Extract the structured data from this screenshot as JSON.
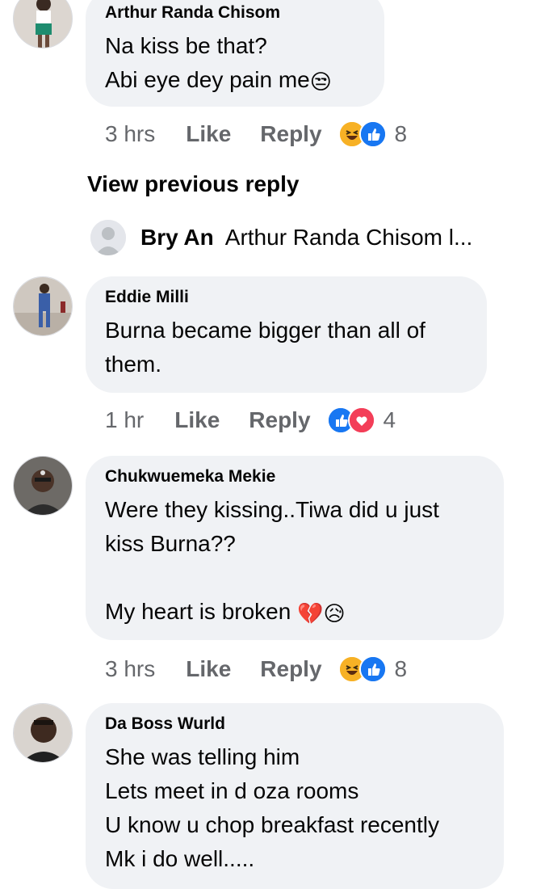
{
  "comments": [
    {
      "name": "Arthur Randa Chisom",
      "text": "Na kiss be that?\nAbi eye dey pain me",
      "emoji": "😒",
      "time": "3 hrs",
      "like": "Like",
      "reply": "Reply",
      "reactions": [
        "haha-icon",
        "like-icon"
      ],
      "count": "8"
    },
    {
      "name": "Eddie Milli",
      "text": "Burna became bigger than all of\nthem.",
      "time": "1 hr",
      "like": "Like",
      "reply": "Reply",
      "reactions": [
        "like-icon",
        "love-icon"
      ],
      "count": "4"
    },
    {
      "name": "Chukwuemeka Mekie",
      "text": "Were they kissing..Tiwa did u just\nkiss Burna??\n\nMy heart is broken",
      "emoji": "💔😥",
      "time": "3 hrs",
      "like": "Like",
      "reply": "Reply",
      "reactions": [
        "haha-icon",
        "like-icon"
      ],
      "count": "8"
    },
    {
      "name": "Da Boss Wurld",
      "text": "She was telling him\nLets meet in d oza rooms\nU know u chop breakfast recently\nMk i do well....."
    }
  ],
  "view_previous": "View previous reply",
  "reply_preview": {
    "name": "Bry An",
    "text": "Arthur Randa Chisom l..."
  },
  "colors": {
    "bubble": "#f0f2f5",
    "meta": "#65676b",
    "like_blue": "#1877f2",
    "love_red": "#f33e58",
    "haha_yellow": "#f7b125"
  }
}
